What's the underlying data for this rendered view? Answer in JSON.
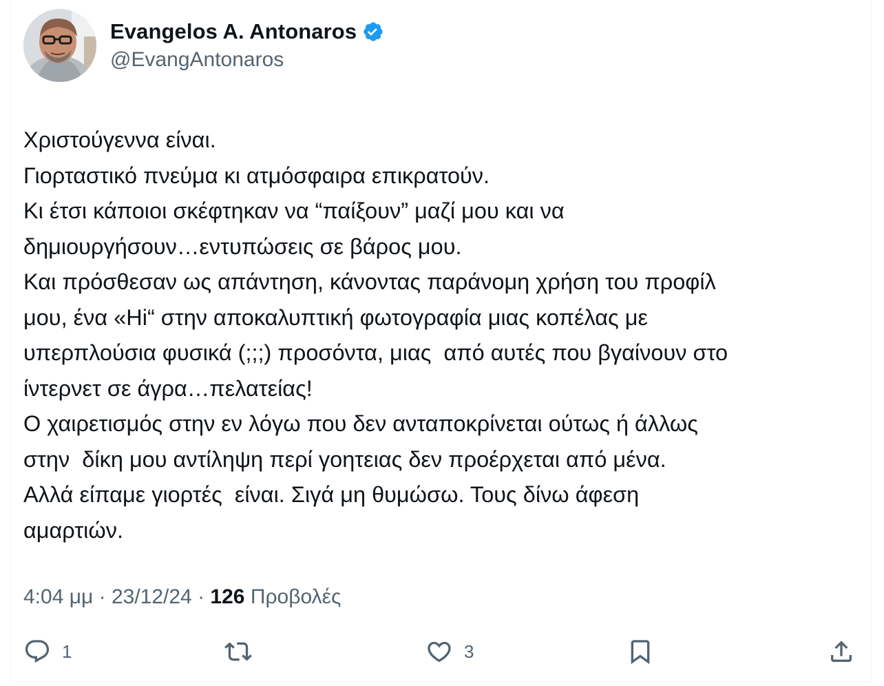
{
  "author": {
    "name": "Evangelos A. Antonaros",
    "handle": "@EvangAntonaros",
    "verified": true,
    "avatar_icon": "profile-photo"
  },
  "tweet": {
    "lines": [
      "Χριστούγεννα είναι.",
      "Γιορταστικό πνεύμα κι ατμόσφαιρα επικρατούν.",
      "Κι έτσι κάποιοι σκέφτηκαν να “παίξουν” μαζί μου και να",
      "δημιουργήσουν…εντυπώσεις σε βάρος μου.",
      "Και πρόσθεσαν ως απάντηση, κάνοντας παράνομη χρήση του προφίλ",
      "μου, ένα «Hi“ στην αποκαλυπτική φωτογραφία μιας κοπέλας με",
      "υπερπλούσια φυσικά (;;;) προσόντα, μιας  από αυτές που βγαίνουν στο",
      "ίντερνετ σε άγρα…πελατείας!",
      "Ο χαιρετισμός στην εν λόγω που δεν ανταποκρίνεται ούτως ή άλλως",
      "στην  δίκη μου αντίληψη περί γοητειας δεν προέρχεται από μένα.",
      "Αλλά είπαμε γιορτές  είναι. Σιγά μη θυμώσω. Τους δίνω άφεση",
      "αμαρτιών."
    ]
  },
  "meta": {
    "time": "4:04 μμ",
    "separator": " · ",
    "date": "23/12/24",
    "views_count": "126",
    "views_label": " Προβολές"
  },
  "actions": {
    "reply": {
      "icon": "reply-icon",
      "count": "1"
    },
    "retweet": {
      "icon": "retweet-icon",
      "count": ""
    },
    "like": {
      "icon": "like-icon",
      "count": "3"
    },
    "bookmark": {
      "icon": "bookmark-icon"
    },
    "share": {
      "icon": "share-icon"
    }
  },
  "colors": {
    "text": "#0f1419",
    "secondary": "#536471",
    "verified": "#1d9bf0",
    "divider": "#eff3f4"
  }
}
